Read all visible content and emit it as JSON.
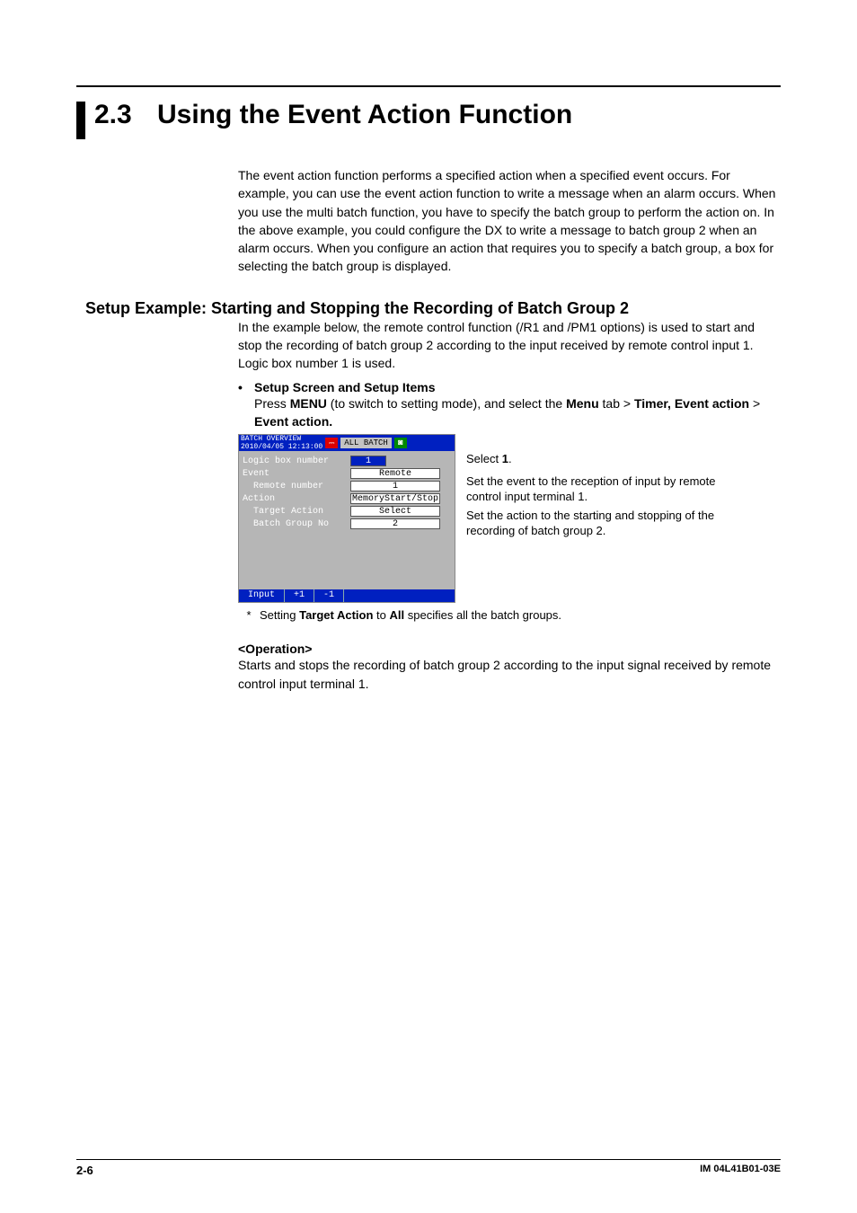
{
  "section": {
    "number": "2.3",
    "title": "Using the Event Action Function"
  },
  "intro": "The event action function performs a specified action when a specified event occurs. For example, you can use the event action function to write a message when an alarm occurs. When you use the multi batch function, you have to specify the batch group to perform the action on. In the above example, you could configure the DX to write a message to batch group 2 when an alarm occurs. When you configure an action that requires you to specify a batch group, a box for selecting the batch group is displayed.",
  "setup_heading": "Setup Example: Starting and Stopping the Recording of Batch Group 2",
  "setup_intro": "In the example below, the remote control function (/R1 and /PM1 options) is used to start and stop the recording of batch group 2 according to the input received by remote control input 1. Logic box number 1 is used.",
  "bullet_title": "Setup Screen and Setup Items",
  "press_line": {
    "p1": "Press ",
    "p2": "MENU",
    "p3": " (to switch to setting mode), and select the ",
    "p4": "Menu",
    "p5": " tab > ",
    "p6": "Timer, Event action",
    "p7": " > ",
    "p8": "Event action."
  },
  "device": {
    "top_title": "BATCH OVERVIEW",
    "top_date": "2010/04/05 12:13:00",
    "all_batch": "ALL BATCH",
    "rows": {
      "logic_label": "Logic box number",
      "logic_val": "1",
      "event_label": "Event",
      "event_val": "Remote",
      "remote_label": "  Remote number",
      "remote_val": "1",
      "action_label": "Action",
      "action_val": "MemoryStart/Stop",
      "target_label": "  Target Action",
      "target_val": "Select",
      "batch_label": "  Batch Group No",
      "batch_val": "2"
    },
    "bottom": {
      "input": "Input",
      "plus": "+1",
      "minus": "-1"
    }
  },
  "callouts": {
    "c1a": "Select ",
    "c1b": "1",
    "c1c": ".",
    "c2": "Set the event to the reception of input by remote control input terminal 1.",
    "c3": "Set the action to the starting and stopping of the recording of batch group 2."
  },
  "footnote": {
    "p1": "Setting ",
    "p2": "Target Action",
    "p3": " to ",
    "p4": "All",
    "p5": " specifies all the batch groups."
  },
  "operation_head": "<Operation>",
  "operation_body": "Starts and stops the recording of batch group 2 according to the input signal received by remote control input terminal 1.",
  "footer": {
    "page": "2-6",
    "doc": "IM 04L41B01-03E"
  }
}
